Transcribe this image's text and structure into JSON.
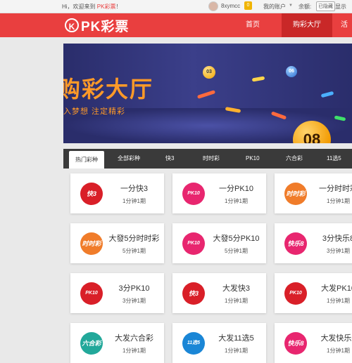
{
  "topbar": {
    "greeting": "Hi，欢迎来到 ",
    "site_name": "PK彩票",
    "site_suffix": "！",
    "username": "8xymcc",
    "message_count": "0",
    "account_label": "我的账户",
    "caret": "▼",
    "balance_label": "余额:",
    "hidden_label": "已隐藏",
    "show_label": "显示"
  },
  "nav": {
    "logo_mark": "K",
    "logo_text": "PK彩票",
    "items": [
      "首页",
      "购彩大厅",
      "活动"
    ]
  },
  "banner": {
    "title": "购彩大厅",
    "slogan": "入梦想 注定精彩",
    "ball_big": "08",
    "ball_left": "03",
    "ball_right": "06"
  },
  "tabs": [
    "热门彩种",
    "全部彩种",
    "快3",
    "时时彩",
    "PK10",
    "六合彩",
    "11选5"
  ],
  "cards": [
    {
      "name": "一分快3",
      "period": "1分钟1期",
      "icon_text": "快3",
      "color": "#d91f28"
    },
    {
      "name": "一分PK10",
      "period": "1分钟1期",
      "icon_text": "PK10",
      "color": "#e8266f"
    },
    {
      "name": "一分时时彩",
      "period": "1分钟1期",
      "icon_text": "时时彩",
      "color": "#f07c2a"
    },
    {
      "name": "大發5分时时彩",
      "period": "5分钟1期",
      "icon_text": "时时彩",
      "color": "#f07c2a"
    },
    {
      "name": "大發5分PK10",
      "period": "5分钟1期",
      "icon_text": "PK10",
      "color": "#e8266f"
    },
    {
      "name": "3分快乐8",
      "period": "3分钟1期",
      "icon_text": "快乐8",
      "color": "#e8266f"
    },
    {
      "name": "3分PK10",
      "period": "3分钟1期",
      "icon_text": "PK10",
      "color": "#d91f28"
    },
    {
      "name": "大发快3",
      "period": "1分钟1期",
      "icon_text": "快3",
      "color": "#d91f28"
    },
    {
      "name": "大发PK10",
      "period": "1分钟1期",
      "icon_text": "PK10",
      "color": "#d91f28"
    },
    {
      "name": "大发六合彩",
      "period": "1分钟1期",
      "icon_text": "六合彩",
      "color": "#22a89a"
    },
    {
      "name": "大发11选5",
      "period": "1分钟1期",
      "icon_text": "11选5",
      "color": "#1a86d6"
    },
    {
      "name": "大发快乐8",
      "period": "1分钟1期",
      "icon_text": "快乐8",
      "color": "#e8266f"
    }
  ]
}
